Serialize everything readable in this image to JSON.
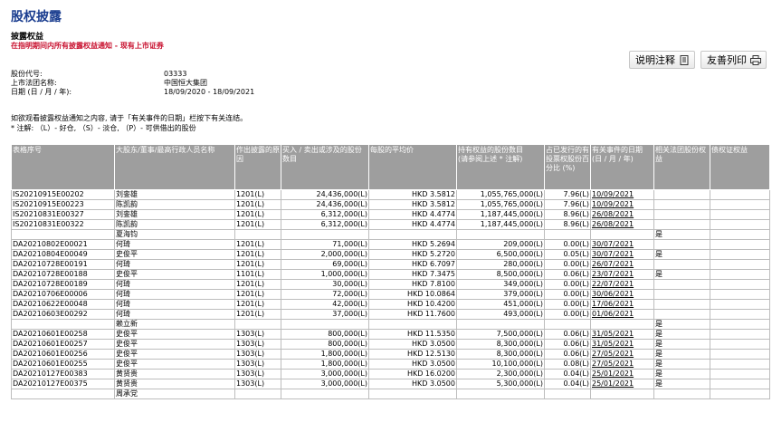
{
  "header": {
    "title": "股权披露",
    "section_title": "披露权益",
    "section_sub": "在指明期间内所有披露权益通知 - 现有上市证券"
  },
  "buttons": {
    "notes_label": "说明注释",
    "print_label": "友善列印"
  },
  "info": {
    "code_label": "股份代号:",
    "code_value": "03333",
    "company_label": "上市法团名称:",
    "company_value": "中国恒大集团",
    "date_label": "日期 (日 / 月 / 年):",
    "date_value": "18/09/2020 - 18/09/2021"
  },
  "notes": {
    "line1": "如欲观看披露权益通知之内容, 请于「有关事件的日期」栏按下有关连结。",
    "line2": "* 注解: （L）- 好仓, （S）- 淡仓, （P）- 可供借出的股份"
  },
  "table": {
    "headers": [
      "表格序号",
      "大股东/董事/最高行政人员名称",
      "作出披露的原因",
      "买入 / 卖出或涉及的股份数目",
      "每股的平均价",
      "持有权益的股份数目\n(请参阅上述 * 注解)",
      "占已发行的有投票权股份百分比 (%)",
      "有关事件的日期 (日 / 月 / 年)",
      "相关法团股份权益",
      "债权证权益"
    ],
    "rows": [
      [
        "IS20210915E00202",
        "刘銮雄",
        "1201(L)",
        "24,436,000(L)",
        "HKD 3.5812",
        "1,055,765,000(L)",
        "7.96(L)",
        "10/09/2021",
        "",
        ""
      ],
      [
        "IS20210915E00223",
        "陈凯韵",
        "1201(L)",
        "24,436,000(L)",
        "HKD 3.5812",
        "1,055,765,000(L)",
        "7.96(L)",
        "10/09/2021",
        "",
        ""
      ],
      [
        "IS20210831E00327",
        "刘銮雄",
        "1201(L)",
        "6,312,000(L)",
        "HKD 4.4774",
        "1,187,445,000(L)",
        "8.96(L)",
        "26/08/2021",
        "",
        ""
      ],
      [
        "IS20210831E00322",
        "陈凯韵",
        "1201(L)",
        "6,312,000(L)",
        "HKD 4.4774",
        "1,187,445,000(L)",
        "8.96(L)",
        "26/08/2021",
        "",
        ""
      ],
      [
        "",
        "夏海钧",
        "",
        "",
        "",
        "",
        "",
        "",
        "是",
        ""
      ],
      [
        "DA20210802E00021",
        "何琦",
        "1201(L)",
        "71,000(L)",
        "HKD 5.2694",
        "209,000(L)",
        "0.00(L)",
        "30/07/2021",
        "",
        ""
      ],
      [
        "DA20210804E00049",
        "史俊平",
        "1201(L)",
        "2,000,000(L)",
        "HKD 5.2720",
        "6,500,000(L)",
        "0.05(L)",
        "30/07/2021",
        "是",
        ""
      ],
      [
        "DA20210728E00191",
        "何琦",
        "1201(L)",
        "69,000(L)",
        "HKD 6.7097",
        "280,000(L)",
        "0.00(L)",
        "26/07/2021",
        "",
        ""
      ],
      [
        "DA20210728E00188",
        "史俊平",
        "1101(L)",
        "1,000,000(L)",
        "HKD 7.3475",
        "8,500,000(L)",
        "0.06(L)",
        "23/07/2021",
        "是",
        ""
      ],
      [
        "DA20210728E00189",
        "何琦",
        "1201(L)",
        "30,000(L)",
        "HKD 7.8100",
        "349,000(L)",
        "0.00(L)",
        "22/07/2021",
        "",
        ""
      ],
      [
        "DA20210706E00006",
        "何琦",
        "1201(L)",
        "72,000(L)",
        "HKD 10.0864",
        "379,000(L)",
        "0.00(L)",
        "30/06/2021",
        "",
        ""
      ],
      [
        "DA20210622E00048",
        "何琦",
        "1201(L)",
        "42,000(L)",
        "HKD 10.4200",
        "451,000(L)",
        "0.00(L)",
        "17/06/2021",
        "",
        ""
      ],
      [
        "DA20210603E00292",
        "何琦",
        "1201(L)",
        "37,000(L)",
        "HKD 11.7600",
        "493,000(L)",
        "0.00(L)",
        "01/06/2021",
        "",
        ""
      ],
      [
        "",
        "赖立新",
        "",
        "",
        "",
        "",
        "",
        "",
        "是",
        ""
      ],
      [
        "DA20210601E00258",
        "史俊平",
        "1303(L)",
        "800,000(L)",
        "HKD 11.5350",
        "7,500,000(L)",
        "0.06(L)",
        "31/05/2021",
        "是",
        ""
      ],
      [
        "DA20210601E00257",
        "史俊平",
        "1303(L)",
        "800,000(L)",
        "HKD 3.0500",
        "8,300,000(L)",
        "0.06(L)",
        "31/05/2021",
        "是",
        ""
      ],
      [
        "DA20210601E00256",
        "史俊平",
        "1303(L)",
        "1,800,000(L)",
        "HKD 12.5130",
        "8,300,000(L)",
        "0.06(L)",
        "27/05/2021",
        "是",
        ""
      ],
      [
        "DA20210601E00255",
        "史俊平",
        "1303(L)",
        "1,800,000(L)",
        "HKD 3.0500",
        "10,100,000(L)",
        "0.08(L)",
        "27/05/2021",
        "是",
        ""
      ],
      [
        "DA20210127E00383",
        "黄贤贵",
        "1303(L)",
        "3,000,000(L)",
        "HKD 16.0200",
        "2,300,000(L)",
        "0.04(L)",
        "25/01/2021",
        "是",
        ""
      ],
      [
        "DA20210127E00375",
        "黄贤贵",
        "1303(L)",
        "3,000,000(L)",
        "HKD 3.0500",
        "5,300,000(L)",
        "0.04(L)",
        "25/01/2021",
        "是",
        ""
      ],
      [
        "",
        "周承党",
        "",
        "",
        "",
        "",
        "",
        "",
        "",
        ""
      ]
    ]
  }
}
